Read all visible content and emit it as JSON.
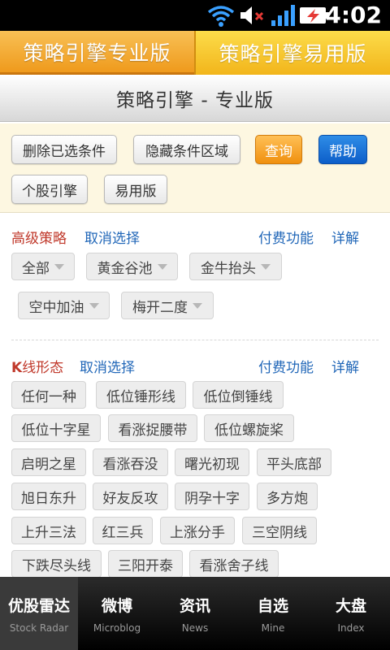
{
  "status_bar": {
    "time": "4:02",
    "wifi_icon": "wifi-icon",
    "volume_icon": "volume-muted-icon",
    "signal_icon": "signal-icon",
    "battery_icon": "battery-charging-icon"
  },
  "tabs": [
    {
      "label": "策略引擎专业版"
    },
    {
      "label": "策略引擎易用版"
    }
  ],
  "title": "策略引擎 - 专业版",
  "controls": {
    "clear_label": "删除已选条件",
    "hide_label": "隐藏条件区域",
    "query_label": "查询",
    "help_label": "帮助",
    "stock_engine_label": "个股引擎",
    "easy_label": "易用版"
  },
  "advanced": {
    "title": "高级策略",
    "cancel": "取消选择",
    "paid": "付费功能",
    "detail": "详解",
    "options": [
      "全部",
      "黄金谷池",
      "金牛抬头",
      "空中加油",
      "梅开二度"
    ]
  },
  "kline": {
    "title_prefix": "K",
    "title_rest": "线形态",
    "cancel": "取消选择",
    "paid": "付费功能",
    "detail": "详解",
    "patterns": [
      "任何一种",
      "低位锤形线",
      "低位倒锤线",
      "低位十字星",
      "看涨捉腰带",
      "低位螺旋桨",
      "启明之星",
      "看涨吞没",
      "曙光初现",
      "平头底部",
      "旭日东升",
      "好友反攻",
      "阴孕十字",
      "多方炮",
      "上升三法",
      "红三兵",
      "上涨分手",
      "三空阴线",
      "下跌尽头线",
      "三阳开泰",
      "看涨舍子线"
    ]
  },
  "bottom_nav": [
    {
      "zh": "优股雷达",
      "en": "Stock Radar"
    },
    {
      "zh": "微博",
      "en": "Microblog"
    },
    {
      "zh": "资讯",
      "en": "News"
    },
    {
      "zh": "自选",
      "en": "Mine"
    },
    {
      "zh": "大盘",
      "en": "Index"
    }
  ]
}
